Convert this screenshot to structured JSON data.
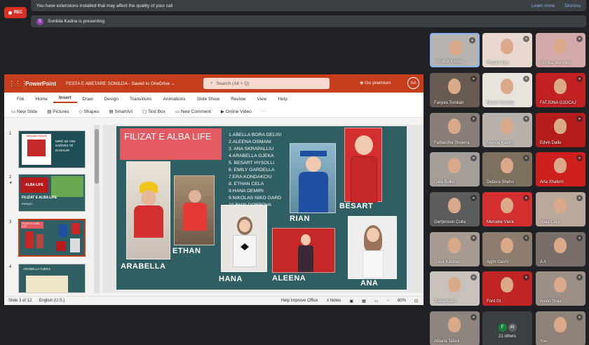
{
  "notice": {
    "text": "You have extensions installed that may affect the quality of your call",
    "learn_more": "Learn more",
    "dismiss": "Dismiss"
  },
  "rec": {
    "label": "REC"
  },
  "presenting": {
    "avatar_letter": "S",
    "text": "Sonilda Kadria is presenting"
  },
  "ppt": {
    "app": "PowerPoint",
    "doc": "FESTA E ABETARE SONILDA  -  Saved to OneDrive",
    "doc_chevron": "⌄",
    "search_placeholder": "Search (Alt + Q)",
    "premium": "Go premium",
    "user_initials": "AA",
    "tabs": [
      "File",
      "Home",
      "Insert",
      "Draw",
      "Design",
      "Transitions",
      "Animations",
      "Slide Show",
      "Review",
      "View",
      "Help"
    ],
    "tools": [
      "New Slide",
      "Pictures",
      "Shapes",
      "SmartArt",
      "Text Box",
      "New Comment",
      "Online Video",
      "···"
    ],
    "status": {
      "slide": "Slide 3 of 12",
      "lang": "English (U.S.)",
      "help": "Help Improve Office",
      "notes": "Notes",
      "zoom": "60%"
    },
    "thumbs": [
      "1",
      "2",
      "3",
      "4"
    ],
    "thumb2_star": "★"
  },
  "slide": {
    "title": "FILIZAT E ALBA LIFE",
    "names": [
      "1.ABELLA BORA DELISI",
      "2.ALEENA OSMANI",
      "3. ANA SKRAPALLIU",
      "4.ARABELLA GJEKA",
      "5. BESART HYSOLLI",
      "6. EMILY GARDELLA",
      "7.ERA KONDAKCIU",
      "8. ETHAN CELA",
      "9.HANA DEMIRI",
      "9.NIKOLAS NIKO GARD",
      "10.RIAN DOBROVA"
    ],
    "labels": {
      "arabella": "ARABELLA",
      "ethan": "ETHAN",
      "hana": "HANA",
      "aleena": "ALEENA",
      "rian": "RIAN",
      "besart": "BESART",
      "ana": "ANA"
    }
  },
  "thumbnail_text": {
    "t1_line1": "MIRË SE VINI",
    "t1_line2": "NXËNËS TË",
    "t1_line3": "DASHUR!",
    "t1_school": "Albanian School",
    "t2_title": "FILIZAT E ALBA LIFE",
    "t2_sub": "PARAQIT...",
    "t2_banner": "ALBA LIFE",
    "t3_title": "FILIZAT E ALBA LIFE",
    "t4_title": "ARABELLA GJEKA"
  },
  "participants": [
    {
      "name": "Sonilda Kadria",
      "bg": "#b7b3ae",
      "active": true,
      "mic": "●"
    },
    {
      "name": "Rozeta Zylo",
      "bg": "#e8d8cf",
      "mic": "✕"
    },
    {
      "name": "Monica skenderi",
      "bg": "#d4a9a9",
      "mic": "✕"
    },
    {
      "name": "Fanjola Toroliari",
      "bg": "#6a5b52",
      "mic": "✕"
    },
    {
      "name": "Mirela Veseliaj",
      "bg": "#e9e3de",
      "mic": "✕"
    },
    {
      "name": "FATJONA GJOCAJ",
      "bg": "#c22121",
      "mic": "✕"
    },
    {
      "name": "Fatbardha Shqerra",
      "bg": "#8a7f78",
      "mic": "✕"
    },
    {
      "name": "Mersije Kasmi",
      "bg": "#b8b0ab",
      "mic": "✕"
    },
    {
      "name": "Edvin Dallu",
      "bg": "#b51d1d",
      "mic": "✕"
    },
    {
      "name": "Gela Bulku",
      "bg": "#a69e99",
      "mic": "✕"
    },
    {
      "name": "Debora Shehu",
      "bg": "#7e705f",
      "mic": "✕"
    },
    {
      "name": "Arta Xhaferri",
      "bg": "#cf2020",
      "mic": "✕"
    },
    {
      "name": "Gertjenson Cuka",
      "bg": "#5c5c5c",
      "mic": "✕"
    },
    {
      "name": "Meruelie Viera",
      "bg": "#d32f2f",
      "mic": "✕"
    },
    {
      "name": "Stela Cela",
      "bg": "#bba89d",
      "mic": "✕"
    },
    {
      "name": "Gona Kastrati",
      "bg": "#a89c92",
      "mic": "✕"
    },
    {
      "name": "Agim Gashi",
      "bg": "#8d7d6f",
      "mic": "✕"
    },
    {
      "name": "A A",
      "bg": "#7a6e6a",
      "mic": "✕"
    },
    {
      "name": "Joana Kaso",
      "bg": "#c9c1bb",
      "mic": "✕"
    },
    {
      "name": "Ford Gt",
      "bg": "#c02424",
      "mic": "✕"
    },
    {
      "name": "Aulon Stoja",
      "bg": "#9c8f86",
      "mic": "✕"
    },
    {
      "name": "Albana Tafani",
      "bg": "#8e857f",
      "mic": "✕"
    },
    {
      "name": "21 others",
      "bg": "#3c4043",
      "others": true
    },
    {
      "name": "You",
      "bg": "#8f8278",
      "mic": "✕"
    }
  ],
  "others_avatars": [
    "F",
    "AI"
  ],
  "colors": {
    "ppt_red": "#c43e1c",
    "slide_bg": "#2f5f63",
    "title_box": "#e35a60",
    "meet_bg": "#202124"
  }
}
